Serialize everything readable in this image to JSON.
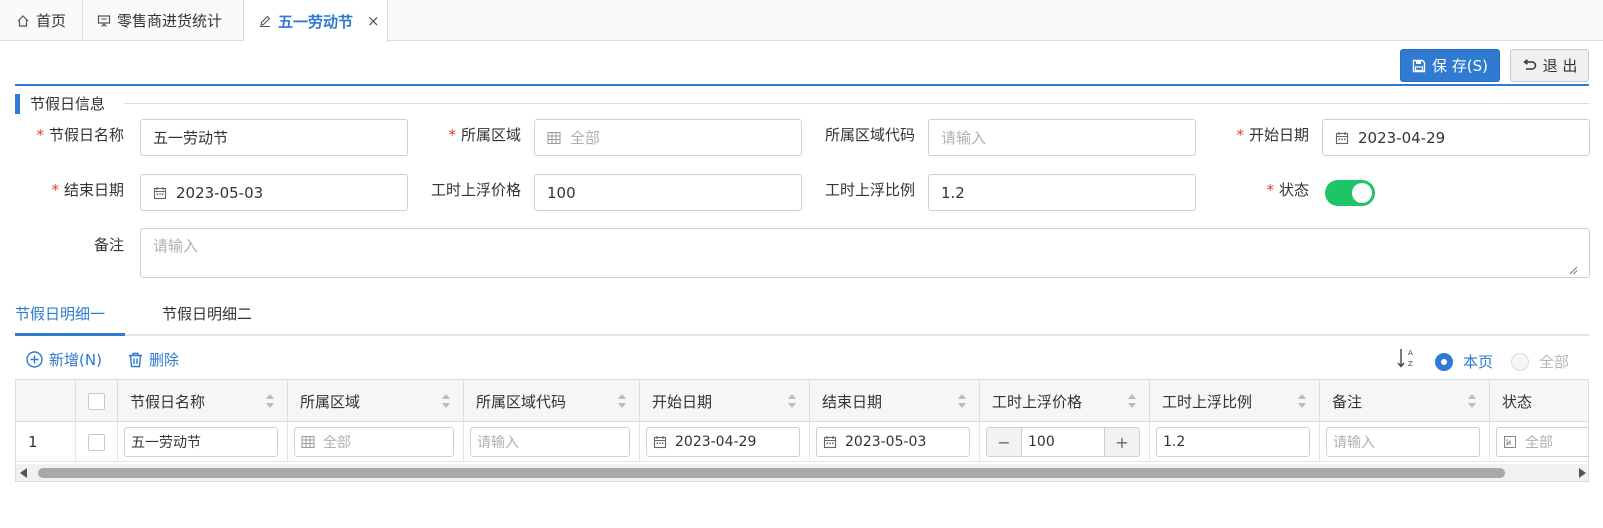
{
  "tabs": [
    {
      "label": "首页",
      "icon": "home-icon"
    },
    {
      "label": "零售商进货统计",
      "icon": "presentation-icon"
    },
    {
      "label": "五一劳动节",
      "icon": "edit-icon",
      "active": true,
      "close": "×"
    }
  ],
  "toolbar": {
    "save_label": "保 存(S)",
    "exit_label": "退 出"
  },
  "section": {
    "title": "节假日信息"
  },
  "form": {
    "holiday_name_label": "节假日名称",
    "holiday_name_value": "五一劳动节",
    "region_label": "所属区域",
    "region_value": "全部",
    "region_code_label": "所属区域代码",
    "region_code_placeholder": "请输入",
    "start_date_label": "开始日期",
    "start_date_value": "2023-04-29",
    "end_date_label": "结束日期",
    "end_date_value": "2023-05-03",
    "hour_price_label": "工时上浮价格",
    "hour_price_value": "100",
    "hour_ratio_label": "工时上浮比例",
    "hour_ratio_value": "1.2",
    "status_label": "状态",
    "status_on": true,
    "remark_label": "备注",
    "remark_placeholder": "请输入",
    "required_mark": "*"
  },
  "detail_tabs": [
    {
      "label": "节假日明细一",
      "active": true
    },
    {
      "label": "节假日明细二",
      "active": false
    }
  ],
  "grid_toolbar": {
    "add_label": "新增(N)",
    "delete_label": "删除",
    "scope_current": "本页",
    "scope_all": "全部",
    "scope_selected": "current"
  },
  "grid": {
    "columns": [
      "节假日名称",
      "所属区域",
      "所属区域代码",
      "开始日期",
      "结束日期",
      "工时上浮价格",
      "工时上浮比例",
      "备注",
      "状态"
    ],
    "rows": [
      {
        "index": "1",
        "holiday_name": "五一劳动节",
        "region": "全部",
        "region_code_placeholder": "请输入",
        "start_date": "2023-04-29",
        "end_date": "2023-05-03",
        "hour_price": "100",
        "stepper_minus": "−",
        "stepper_plus": "+",
        "hour_ratio": "1.2",
        "remark_placeholder": "请输入",
        "status": "全部"
      }
    ]
  },
  "colors": {
    "accent": "#2f7bd1",
    "toggle_on": "#1fc466",
    "required": "#e53935"
  }
}
